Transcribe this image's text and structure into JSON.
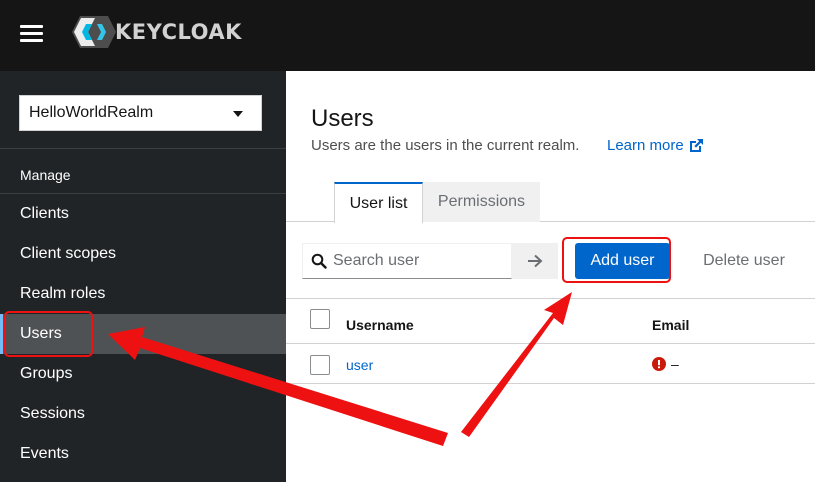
{
  "masthead": {
    "brand": "KEYCLOAK"
  },
  "sidebar": {
    "realm": "HelloWorldRealm",
    "section": "Manage",
    "items": [
      {
        "label": "Clients"
      },
      {
        "label": "Client scopes"
      },
      {
        "label": "Realm roles"
      },
      {
        "label": "Users",
        "active": true
      },
      {
        "label": "Groups"
      },
      {
        "label": "Sessions"
      },
      {
        "label": "Events"
      }
    ]
  },
  "main": {
    "title": "Users",
    "description": "Users are the users in the current realm.",
    "learn_more": "Learn more",
    "tabs": [
      {
        "label": "User list",
        "active": true
      },
      {
        "label": "Permissions"
      }
    ],
    "toolbar": {
      "search_placeholder": "Search user",
      "add_user": "Add user",
      "delete_user": "Delete user"
    },
    "table": {
      "columns": [
        "Username",
        "Email"
      ],
      "rows": [
        {
          "username": "user",
          "email": "–"
        }
      ]
    }
  },
  "colors": {
    "masthead": "#151515",
    "sidebar": "#212427",
    "active_nav": "#4f5255",
    "primary": "#0066cc",
    "annotation": "#ee1111"
  }
}
